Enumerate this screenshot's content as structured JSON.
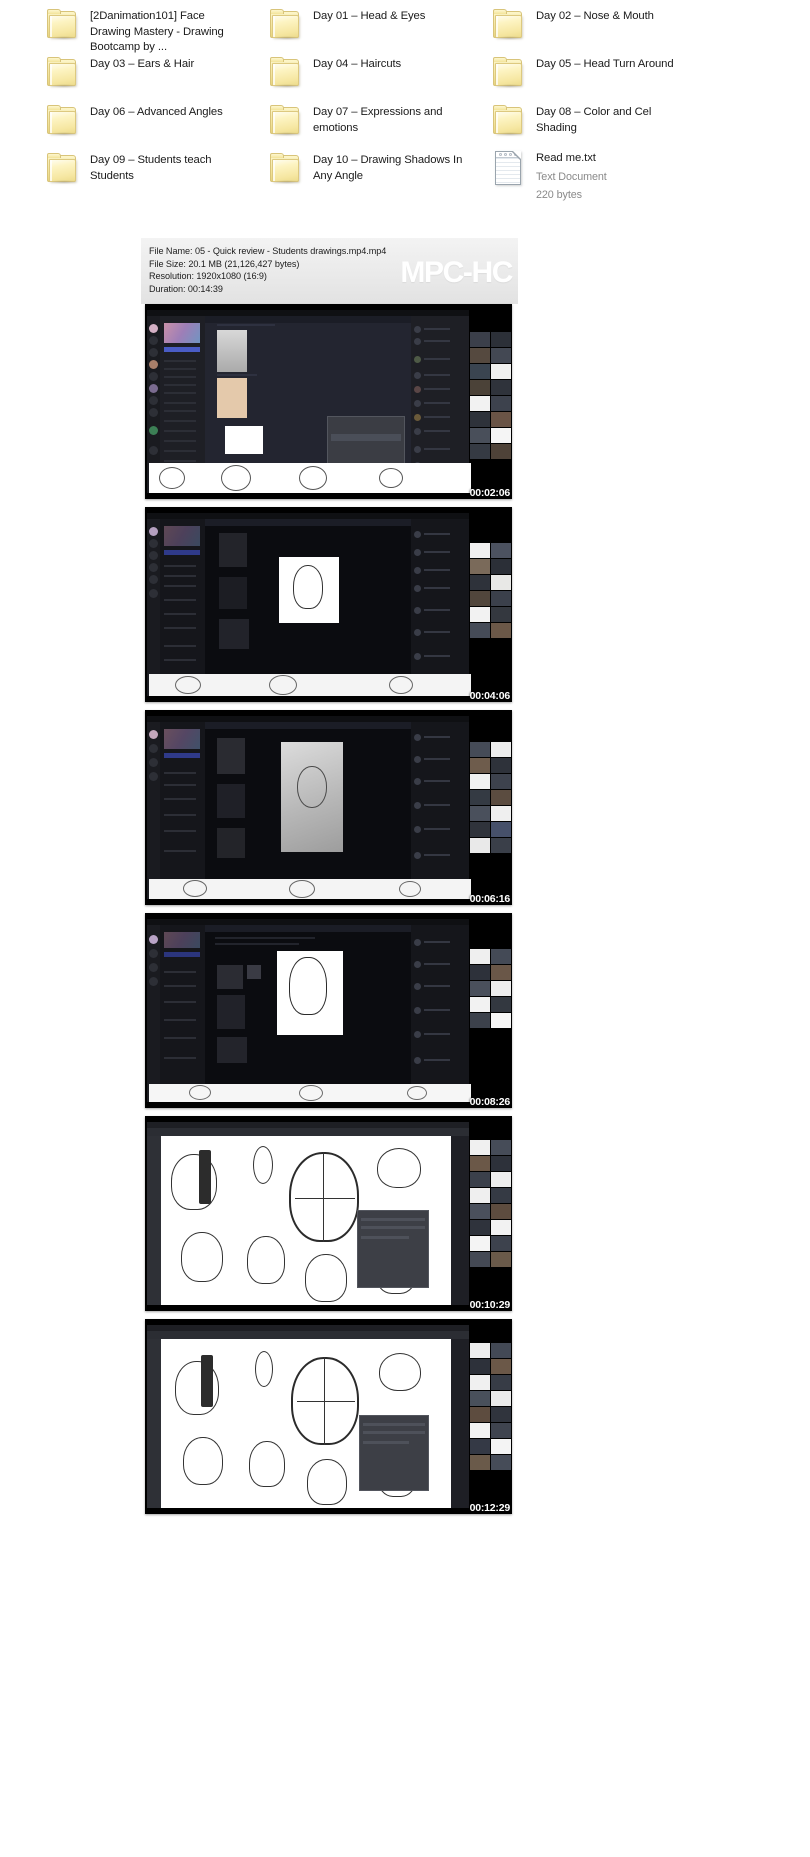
{
  "explorer": {
    "view": "large-icons",
    "items": [
      {
        "name": "[2Danimation101] Face Drawing Mastery - Drawing Bootcamp by ...",
        "type": "folder",
        "row": 0,
        "col": 0
      },
      {
        "name": "Day 01 – Head & Eyes",
        "type": "folder",
        "row": 0,
        "col": 1
      },
      {
        "name": "Day 02 – Nose & Mouth",
        "type": "folder",
        "row": 0,
        "col": 2
      },
      {
        "name": "Day 03 – Ears & Hair",
        "type": "folder",
        "row": 1,
        "col": 0
      },
      {
        "name": "Day 04 – Haircuts",
        "type": "folder",
        "row": 1,
        "col": 1
      },
      {
        "name": "Day 05 – Head Turn Around",
        "type": "folder",
        "row": 1,
        "col": 2
      },
      {
        "name": "Day 06 – Advanced Angles",
        "type": "folder",
        "row": 2,
        "col": 0
      },
      {
        "name": "Day 07 – Expressions and emotions",
        "type": "folder",
        "row": 2,
        "col": 1
      },
      {
        "name": "Day 08 – Color and Cel Shading",
        "type": "folder",
        "row": 2,
        "col": 2
      },
      {
        "name": "Day 09 – Students teach Students",
        "type": "folder",
        "row": 3,
        "col": 0
      },
      {
        "name": "Day 10 – Drawing Shadows In Any Angle",
        "type": "folder",
        "row": 3,
        "col": 1
      },
      {
        "name": "Read me.txt",
        "type": "textfile",
        "subtype": "Text Document",
        "size": "220 bytes",
        "row": 3,
        "col": 2
      }
    ]
  },
  "contact_sheet": {
    "watermark": "MPC-HC",
    "metadata": [
      "File Name: 05 - Quick review - Students drawings.mp4.mp4",
      "File Size: 20.1 MB (21,126,427 bytes)",
      "Resolution: 1920x1080 (16:9)",
      "Duration: 00:14:39"
    ],
    "meta_fields": {
      "file_name_label": "File Name:",
      "file_name": "05 - Quick review - Students drawings.mp4.mp4",
      "file_size_label": "File Size:",
      "file_size": "20.1 MB (21,126,427 bytes)",
      "resolution_label": "Resolution:",
      "resolution": "1920x1080 (16:9)",
      "duration_label": "Duration:",
      "duration": "00:14:39"
    },
    "thumbnails": [
      {
        "timestamp": "00:02:06",
        "scene": "discord-drawing-channel"
      },
      {
        "timestamp": "00:04:06",
        "scene": "discord-face-sketch-white"
      },
      {
        "timestamp": "00:06:16",
        "scene": "discord-pencil-portrait"
      },
      {
        "timestamp": "00:08:26",
        "scene": "discord-inked-portrait"
      },
      {
        "timestamp": "00:10:29",
        "scene": "drawing-app-head-constructions"
      },
      {
        "timestamp": "00:12:29",
        "scene": "drawing-app-head-constructions-2"
      }
    ]
  }
}
